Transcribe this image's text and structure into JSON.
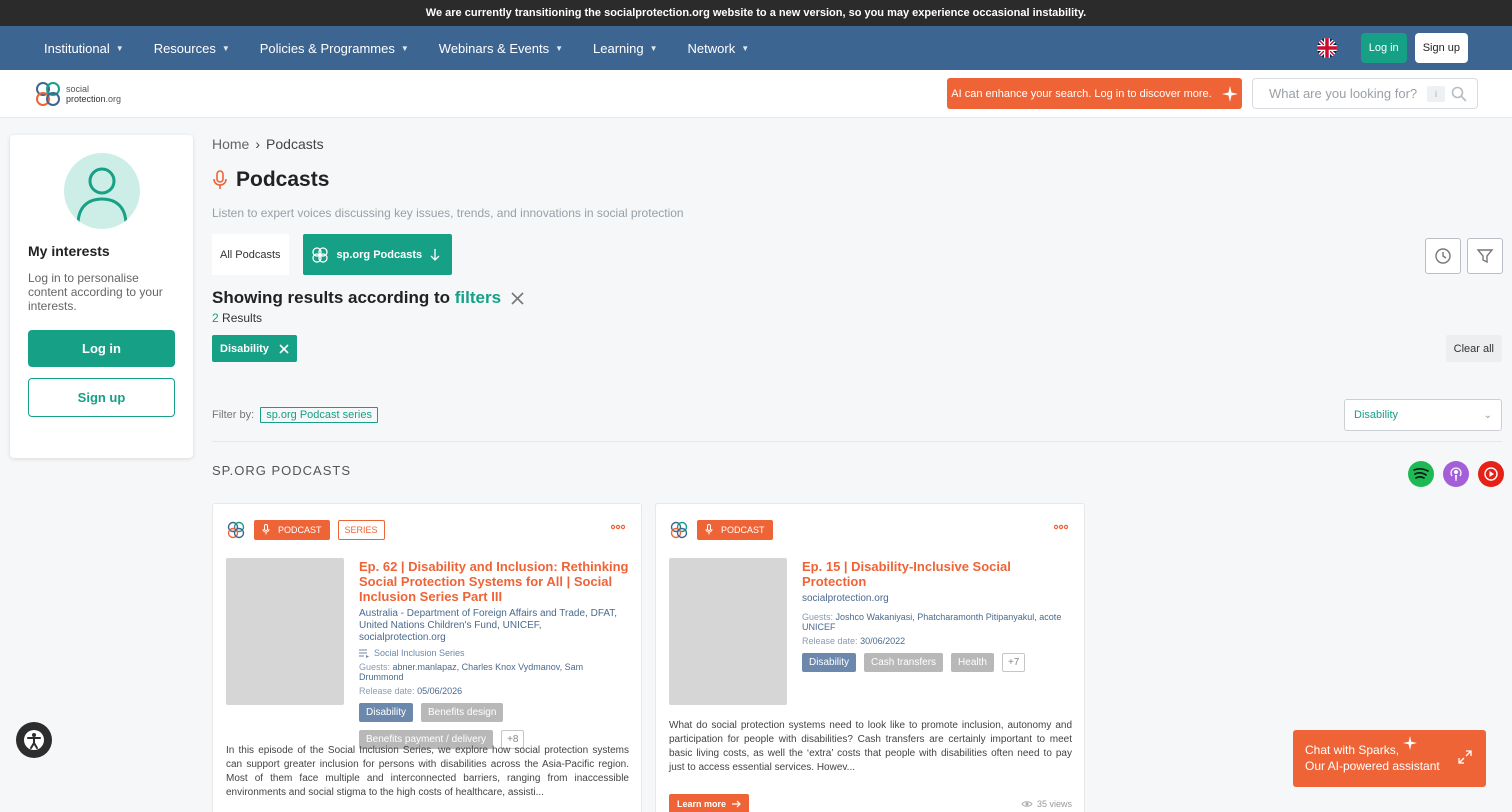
{
  "banner": {
    "text": "We are currently transitioning the socialprotection.org website to a new version, so you may experience occasional instability."
  },
  "nav": {
    "items": [
      {
        "label": "Institutional"
      },
      {
        "label": "Resources"
      },
      {
        "label": "Policies & Programmes"
      },
      {
        "label": "Webinars & Events"
      },
      {
        "label": "Learning"
      },
      {
        "label": "Network"
      }
    ],
    "login": "Log in",
    "signup": "Sign up"
  },
  "header": {
    "logo_line1": "social",
    "logo_line2": "protection",
    "logo_line3": ".org",
    "ai_banner": "AI can enhance your search. Log in to discover more.",
    "search_placeholder": "What are you looking for?"
  },
  "sidebar": {
    "title": "My interests",
    "text": "Log in to personalise content according to your interests.",
    "login": "Log in",
    "signup": "Sign up"
  },
  "breadcrumb": {
    "home": "Home",
    "sep": "›",
    "current": "Podcasts"
  },
  "page": {
    "title": "Podcasts",
    "subtitle": "Listen to expert voices discussing key issues, trends, and innovations in social protection"
  },
  "tabs": {
    "all": "All Podcasts",
    "sp": "sp.org Podcasts"
  },
  "results": {
    "heading_prefix": "Showing results according to",
    "heading_link": "filters",
    "count": "2",
    "count_label": "Results",
    "chip": "Disability",
    "clear_all": "Clear all"
  },
  "filter": {
    "label": "Filter by:",
    "tag": "sp.org Podcast series",
    "select_value": "Disability"
  },
  "section": {
    "title": "SP.ORG PODCASTS"
  },
  "cards": [
    {
      "badge": "PODCAST",
      "series_badge": "SERIES",
      "title": "Ep. 62 | Disability and Inclusion: Rethinking Social Protection Systems for All | Social Inclusion Series Part III",
      "org": "Australia - Department of Foreign Affairs and Trade, DFAT, United Nations Children's Fund, UNICEF, socialprotection.org",
      "series": "Social Inclusion Series",
      "guests_label": "Guests:",
      "guests": "abner.manlapaz, Charles Knox Vydmanov, Sam Drummond",
      "release_label": "Release date:",
      "release": "05/06/2026",
      "tags": [
        "Disability",
        "Benefits design",
        "Benefits payment / delivery",
        "+8"
      ],
      "description": "In this episode of the Social Inclusion Series, we explore how social protection systems can support greater inclusion for persons with disabilities across the Asia-Pacific region. Most of them face multiple and interconnected barriers, ranging from inaccessible environments and social stigma to the high costs of healthcare, assisti..."
    },
    {
      "badge": "PODCAST",
      "title": "Ep. 15 | Disability-Inclusive Social Protection",
      "org": "socialprotection.org",
      "guests_label": "Guests:",
      "guests": "Joshco Wakaniyasi, Phatcharamonth Pitipanyakul, acote UNICEF",
      "release_label": "Release date:",
      "release": "30/06/2022",
      "tags": [
        "Disability",
        "Cash transfers",
        "Health",
        "+7"
      ],
      "description": "What do social protection systems need to look like to promote inclusion, autonomy and participation for people with disabilities? Cash transfers are certainly important to meet basic living costs, as well the ‘extra’ costs that people with disabilities often need to pay just to access essential services. Howev...",
      "learn_more": "Learn more",
      "views": "35 views"
    }
  ],
  "chat": {
    "line1": "Chat with Sparks,",
    "line2": "Our AI-powered assistant"
  },
  "colors": {
    "brand_green": "#16a085",
    "brand_orange": "#ef6437",
    "nav_blue": "#3d6591"
  }
}
